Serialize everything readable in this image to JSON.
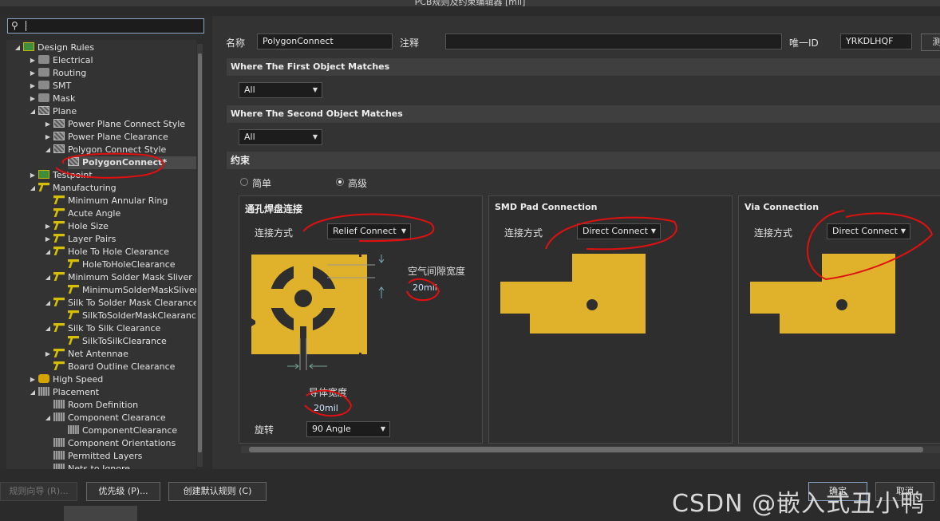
{
  "window": {
    "title": "PCB规则及约束编辑器 [mil]"
  },
  "search": {
    "value": ""
  },
  "tree": [
    {
      "label": "Design Rules",
      "depth": 0,
      "icon": "design-rules-icon"
    },
    {
      "label": "Electrical",
      "depth": 1,
      "icon": "electrical-icon"
    },
    {
      "label": "Routing",
      "depth": 1,
      "icon": "routing-icon"
    },
    {
      "label": "SMT",
      "depth": 1,
      "icon": "smt-icon"
    },
    {
      "label": "Mask",
      "depth": 1,
      "icon": "mask-icon"
    },
    {
      "label": "Plane",
      "depth": 1,
      "icon": "plane-icon"
    },
    {
      "label": "Power Plane Connect Style",
      "depth": 2,
      "icon": "plane-rule-icon"
    },
    {
      "label": "Power Plane Clearance",
      "depth": 2,
      "icon": "plane-rule-icon"
    },
    {
      "label": "Polygon Connect Style",
      "depth": 2,
      "icon": "plane-rule-icon"
    },
    {
      "label": "PolygonConnect*",
      "depth": 3,
      "icon": "plane-rule-icon",
      "selected": true
    },
    {
      "label": "Testpoint",
      "depth": 1,
      "icon": "testpoint-icon"
    },
    {
      "label": "Manufacturing",
      "depth": 1,
      "icon": "manufacturing-icon"
    },
    {
      "label": "Minimum Annular Ring",
      "depth": 2,
      "icon": "rule-icon"
    },
    {
      "label": "Acute Angle",
      "depth": 2,
      "icon": "rule-icon"
    },
    {
      "label": "Hole Size",
      "depth": 2,
      "icon": "rule-icon"
    },
    {
      "label": "Layer Pairs",
      "depth": 2,
      "icon": "rule-icon"
    },
    {
      "label": "Hole To Hole Clearance",
      "depth": 2,
      "icon": "rule-icon"
    },
    {
      "label": "HoleToHoleClearance",
      "depth": 3,
      "icon": "rule-icon"
    },
    {
      "label": "Minimum Solder Mask Sliver",
      "depth": 2,
      "icon": "rule-icon"
    },
    {
      "label": "MinimumSolderMaskSliver",
      "depth": 3,
      "icon": "rule-icon"
    },
    {
      "label": "Silk To Solder Mask Clearance",
      "depth": 2,
      "icon": "rule-icon"
    },
    {
      "label": "SilkToSolderMaskClearance",
      "depth": 3,
      "icon": "rule-icon"
    },
    {
      "label": "Silk To Silk Clearance",
      "depth": 2,
      "icon": "rule-icon"
    },
    {
      "label": "SilkToSilkClearance",
      "depth": 3,
      "icon": "rule-icon"
    },
    {
      "label": "Net Antennae",
      "depth": 2,
      "icon": "rule-icon"
    },
    {
      "label": "Board Outline Clearance",
      "depth": 2,
      "icon": "rule-icon"
    },
    {
      "label": "High Speed",
      "depth": 1,
      "icon": "high-speed-icon"
    },
    {
      "label": "Placement",
      "depth": 1,
      "icon": "placement-icon"
    },
    {
      "label": "Room Definition",
      "depth": 2,
      "icon": "placement-rule-icon"
    },
    {
      "label": "Component Clearance",
      "depth": 2,
      "icon": "placement-rule-icon"
    },
    {
      "label": "ComponentClearance",
      "depth": 3,
      "icon": "placement-rule-icon"
    },
    {
      "label": "Component Orientations",
      "depth": 2,
      "icon": "placement-rule-icon"
    },
    {
      "label": "Permitted Layers",
      "depth": 2,
      "icon": "placement-rule-icon"
    },
    {
      "label": "Nets to Ignore",
      "depth": 2,
      "icon": "placement-rule-icon"
    }
  ],
  "rule": {
    "name_label": "名称",
    "name_value": "PolygonConnect",
    "comment_label": "注释",
    "comment_value": "",
    "uid_label": "唯一ID",
    "uid_value": "YRKDLHQF",
    "test_label": "测"
  },
  "first_match": {
    "title": "Where The First Object Matches",
    "value": "All"
  },
  "second_match": {
    "title": "Where The Second Object Matches",
    "value": "All"
  },
  "constraints": {
    "title": "约束",
    "mode_simple": "简单",
    "mode_advanced": "高级",
    "mode_selected": "advanced"
  },
  "through_hole": {
    "title": "通孔焊盘连接",
    "connect_label": "连接方式",
    "connect_value": "Relief Connect",
    "air_gap_label": "空气间隙宽度",
    "air_gap_value": "20mil",
    "conductor_label": "导体宽度",
    "conductor_value": "20mil",
    "rotation_label": "旋转",
    "rotation_value": "90 Angle"
  },
  "smd": {
    "title": "SMD Pad Connection",
    "connect_label": "连接方式",
    "connect_value": "Direct Connect"
  },
  "via": {
    "title": "Via Connection",
    "connect_label": "连接方式",
    "connect_value": "Direct Connect"
  },
  "buttons": {
    "wizard": "规则向导 (R)...",
    "priority": "优先级 (P)...",
    "create_default": "创建默认规则 (C)",
    "ok": "确定",
    "cancel": "取消"
  },
  "watermark": "CSDN @嵌入式丑小鸭",
  "colors": {
    "copper": "#e0b12b",
    "annotation": "#e01010",
    "background": "#2b2b2b"
  }
}
